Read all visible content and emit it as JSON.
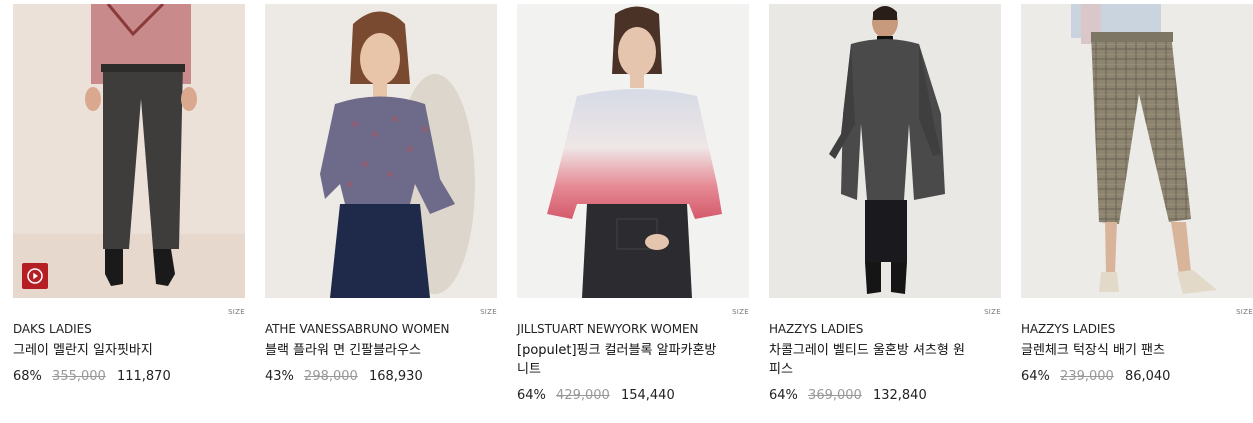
{
  "products": [
    {
      "brand": "DAKS LADIES",
      "name": "그레이 멜란지 일자핏바지",
      "discount": "68%",
      "original_price": "355,000",
      "sale_price": "111,870",
      "size_label": "SIZE",
      "image": "dark-grey-straight-trousers-photo",
      "has_video": true
    },
    {
      "brand": "ATHE VANESSABRUNO WOMEN",
      "name": "블랙 플라워 면 긴팔블라우스",
      "discount": "43%",
      "original_price": "298,000",
      "sale_price": "168,930",
      "size_label": "SIZE",
      "image": "floral-blouse-navy-skirt-photo"
    },
    {
      "brand": "JILLSTUART NEWYORK WOMEN",
      "name": "[populet]핑크 컬러블록 알파카혼방 니트",
      "discount": "64%",
      "original_price": "429,000",
      "sale_price": "154,440",
      "size_label": "SIZE",
      "image": "pink-gradient-knit-sweater-photo"
    },
    {
      "brand": "HAZZYS LADIES",
      "name": "차콜그레이 벨티드 울혼방 셔츠형 원피스",
      "discount": "64%",
      "original_price": "369,000",
      "sale_price": "132,840",
      "size_label": "SIZE",
      "image": "charcoal-shirt-dress-coat-photo"
    },
    {
      "brand": "HAZZYS LADIES",
      "name": "글렌체크 턱장식 배기 팬츠",
      "discount": "64%",
      "original_price": "239,000",
      "sale_price": "86,040",
      "size_label": "SIZE",
      "image": "glen-check-cropped-pants-photo"
    }
  ],
  "colors": {
    "video_badge": "#b51f24",
    "strike_price": "#999999",
    "text": "#222222"
  },
  "icons": {
    "video": "play-circle-icon"
  }
}
